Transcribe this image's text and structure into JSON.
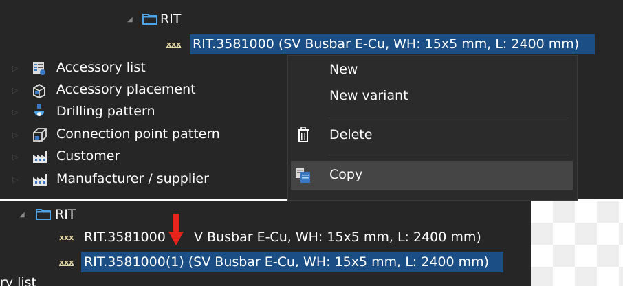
{
  "top_tree": {
    "folder_label": "RIT",
    "selected_item": {
      "icon_text": "xxx",
      "label": "RIT.3581000 (SV Busbar E-Cu, WH: 15x5 mm, L: 2400 mm)"
    },
    "categories": [
      {
        "label": "Accessory list",
        "icon": "accessory-list-icon"
      },
      {
        "label": "Accessory placement",
        "icon": "accessory-placement-icon"
      },
      {
        "label": "Drilling pattern",
        "icon": "drilling-pattern-icon"
      },
      {
        "label": "Connection point pattern",
        "icon": "connection-point-pattern-icon"
      },
      {
        "label": "Customer",
        "icon": "factory-icon"
      },
      {
        "label": "Manufacturer / supplier",
        "icon": "factory-icon"
      }
    ]
  },
  "context_menu": {
    "items": [
      {
        "label": "New",
        "icon": ""
      },
      {
        "label": "New variant",
        "icon": ""
      },
      {
        "label": "Delete",
        "icon": "trash-icon"
      },
      {
        "label": "Copy",
        "icon": "copy-icon",
        "hovered": true
      }
    ]
  },
  "bottom_tree": {
    "folder_label": "RIT",
    "items": [
      {
        "icon_text": "xxx",
        "label_before": "RIT.3581000",
        "label_after": "V Busbar E-Cu, WH: 15x5 mm, L: 2400 mm)",
        "selected": false
      },
      {
        "icon_text": "xxx",
        "label": "RIT.3581000(1) (SV Busbar E-Cu, WH: 15x5 mm, L: 2400 mm)",
        "selected": true
      }
    ],
    "partial_label": "ry list"
  },
  "colors": {
    "panel_bg": "#262626",
    "selection": "#1c4e86",
    "folder_icon": "#4da3e6",
    "annotation_arrow": "#e8231c",
    "item_icon_text": "#e8d9a8"
  }
}
